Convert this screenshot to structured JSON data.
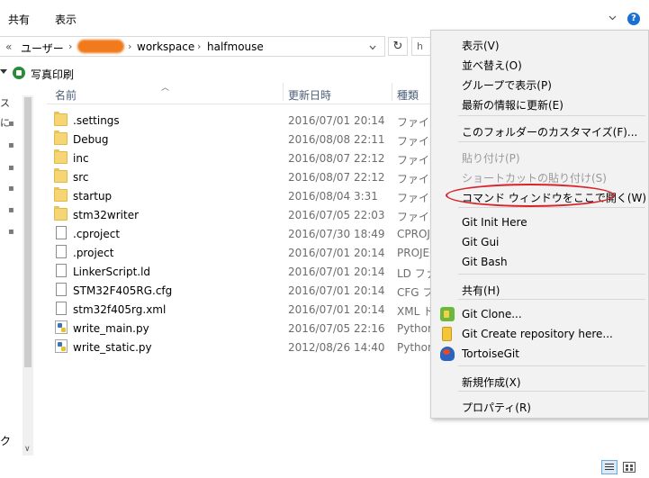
{
  "ribbon": {
    "tabs": [
      "共有",
      "表示"
    ],
    "help_glyph": "?"
  },
  "address": {
    "back_glyph": "«",
    "segments": [
      "ユーザー",
      "workspace",
      "halfmouse"
    ],
    "separator": "›",
    "refresh_glyph": "↻",
    "search_glyph": "h"
  },
  "toolbar": {
    "print_label": "写真印刷"
  },
  "nav": {
    "frag_top": "ス",
    "frag_mid": "に",
    "frag_bottom": "ク",
    "scroll_down": "∨"
  },
  "list": {
    "columns": {
      "name": "名前",
      "date": "更新日時",
      "type": "種類"
    },
    "sort_glyph": "︿",
    "rows": [
      {
        "kind": "folder",
        "name": ".settings",
        "date": "2016/07/01 20:14",
        "type": "ファイル"
      },
      {
        "kind": "folder",
        "name": "Debug",
        "date": "2016/08/08 22:11",
        "type": "ファイル"
      },
      {
        "kind": "folder",
        "name": "inc",
        "date": "2016/08/07 22:12",
        "type": "ファイル"
      },
      {
        "kind": "folder",
        "name": "src",
        "date": "2016/08/07 22:12",
        "type": "ファイル"
      },
      {
        "kind": "folder",
        "name": "startup",
        "date": "2016/08/04 3:31",
        "type": "ファイル"
      },
      {
        "kind": "folder",
        "name": "stm32writer",
        "date": "2016/07/05 22:03",
        "type": "ファイル"
      },
      {
        "kind": "doc",
        "name": ".cproject",
        "date": "2016/07/30 18:49",
        "type": "CPROJ"
      },
      {
        "kind": "doc",
        "name": ".project",
        "date": "2016/07/01 20:14",
        "type": "PROJEC"
      },
      {
        "kind": "doc",
        "name": "LinkerScript.ld",
        "date": "2016/07/01 20:14",
        "type": "LD ファ"
      },
      {
        "kind": "doc",
        "name": "STM32F405RG.cfg",
        "date": "2016/07/01 20:14",
        "type": "CFG ファ"
      },
      {
        "kind": "doc",
        "name": "stm32f405rg.xml",
        "date": "2016/07/01 20:14",
        "type": "XML ド"
      },
      {
        "kind": "py",
        "name": "write_main.py",
        "date": "2016/07/05 22:16",
        "type": "Python"
      },
      {
        "kind": "py",
        "name": "write_static.py",
        "date": "2012/08/26 14:40",
        "type": "Python"
      }
    ]
  },
  "context_menu": {
    "items": [
      {
        "label": "表示(V)",
        "state": "enabled"
      },
      {
        "label": "並べ替え(O)",
        "state": "enabled"
      },
      {
        "label": "グループで表示(P)",
        "state": "enabled"
      },
      {
        "label": "最新の情報に更新(E)",
        "state": "enabled"
      },
      {
        "label": "このフォルダーのカスタマイズ(F)...",
        "state": "enabled"
      },
      {
        "label": "貼り付け(P)",
        "state": "disabled"
      },
      {
        "label": "ショートカットの貼り付け(S)",
        "state": "disabled"
      },
      {
        "label": "コマンド ウィンドウをここで開く(W)",
        "state": "enabled",
        "highlight_color": "#d8232a"
      },
      {
        "label": "Git Init Here",
        "state": "enabled"
      },
      {
        "label": "Git Gui",
        "state": "enabled"
      },
      {
        "label": "Git Bash",
        "state": "enabled"
      },
      {
        "label": "共有(H)",
        "state": "enabled"
      },
      {
        "label": "Git Clone...",
        "state": "enabled",
        "icon": "git-clone-icon"
      },
      {
        "label": "Git Create repository here...",
        "state": "enabled",
        "icon": "git-create-repo-icon"
      },
      {
        "label": "TortoiseGit",
        "state": "enabled",
        "icon": "tortoisegit-icon"
      },
      {
        "label": "新規作成(X)",
        "state": "enabled"
      },
      {
        "label": "プロパティ(R)",
        "state": "enabled"
      }
    ]
  },
  "colors": {
    "accent": "#1a6fd4",
    "highlight_ellipse": "#d8232a",
    "folder": "#f6d575",
    "redaction": "#f07a1c"
  }
}
